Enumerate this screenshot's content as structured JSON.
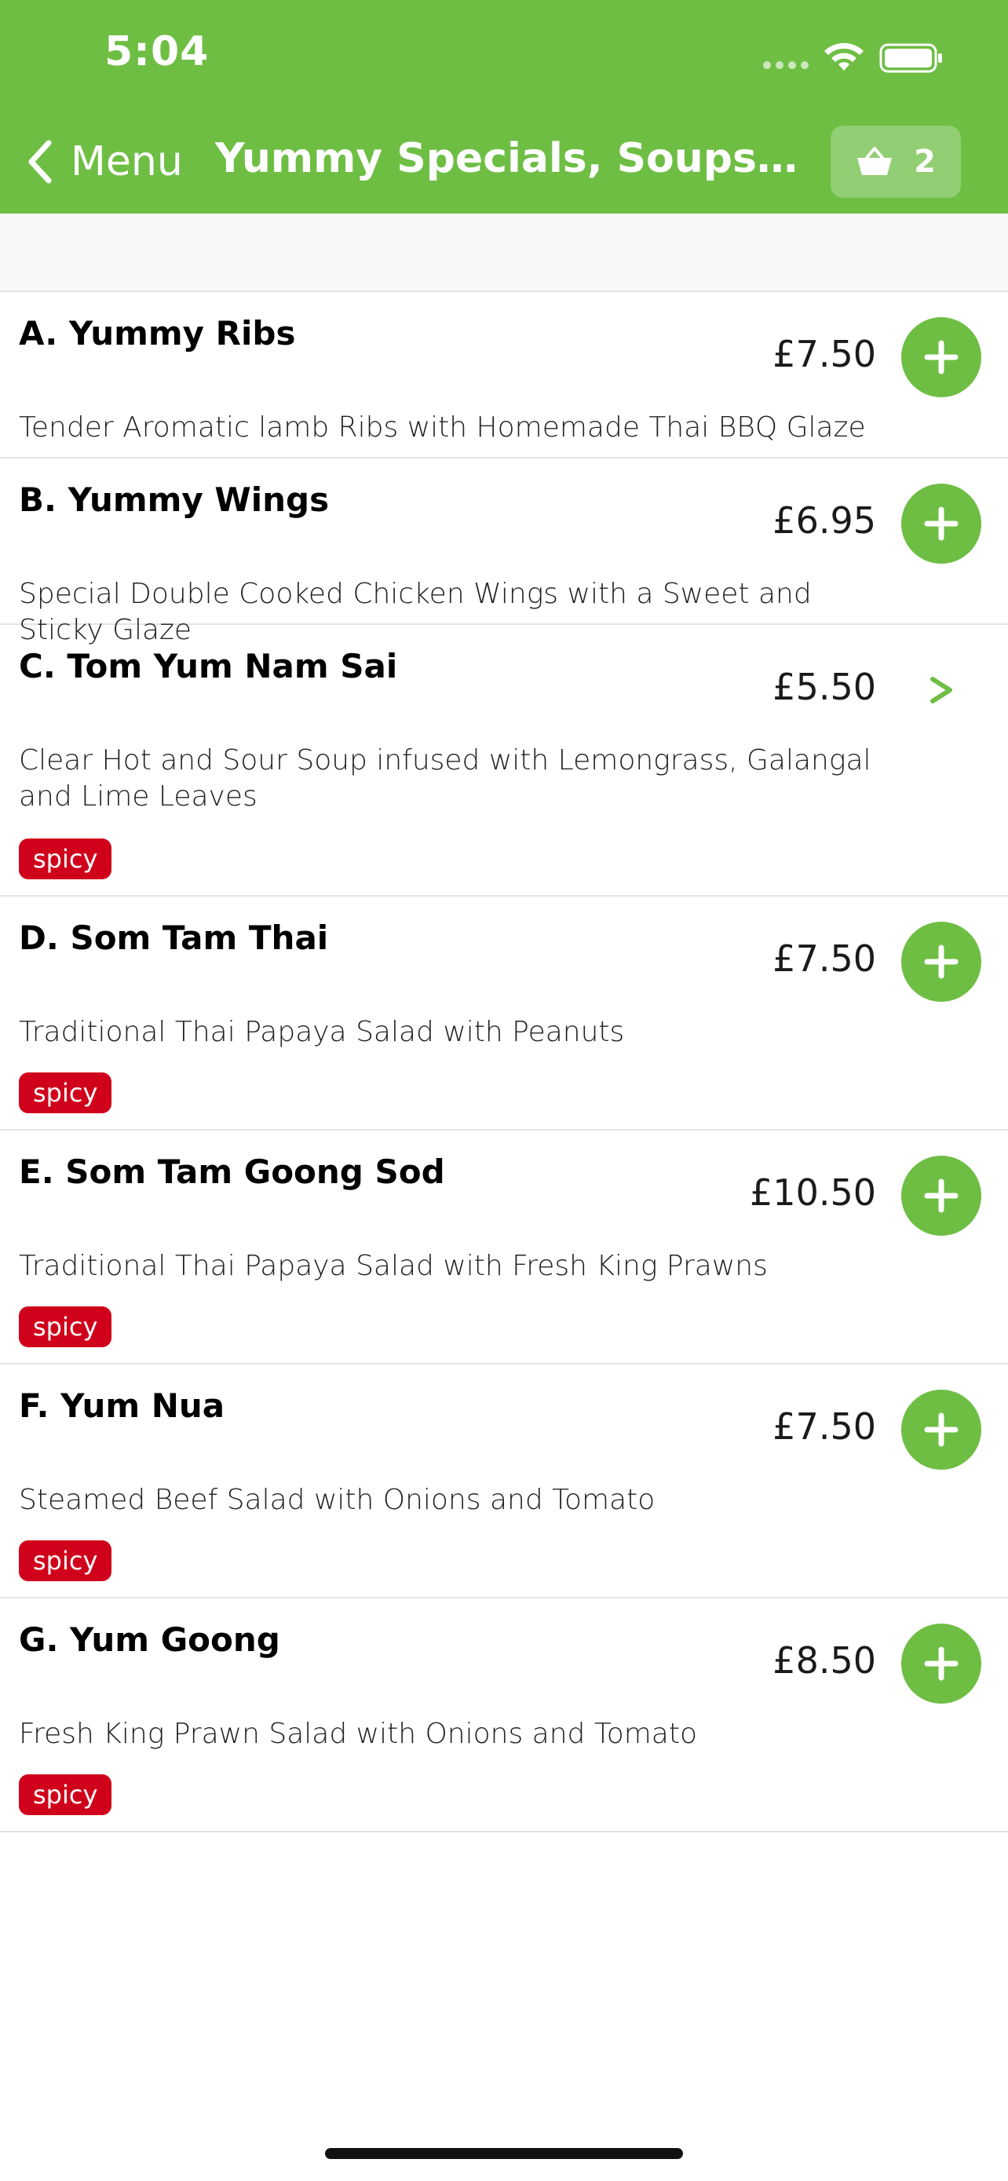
{
  "status_bar": {
    "time": "5:04"
  },
  "nav": {
    "back_label": "Menu",
    "title": "Yummy Specials, Soups, and S…",
    "basket_count": "2"
  },
  "colors": {
    "brand_green": "#6ebe44",
    "spicy_red": "#d0021b"
  },
  "items": [
    {
      "name": "A. Yummy Ribs",
      "price": "£7.50",
      "description": "Tender Aromatic lamb Ribs with Homemade Thai BBQ Glaze",
      "action": "add",
      "badge": ""
    },
    {
      "name": "B. Yummy Wings",
      "price": "£6.95",
      "description": "Special Double Cooked Chicken Wings with a Sweet and Sticky Glaze",
      "action": "add",
      "badge": ""
    },
    {
      "name": "C. Tom Yum Nam Sai",
      "price": "£5.50",
      "description": "Clear Hot and Sour Soup infused with Lemongrass, Galangal and Lime Leaves",
      "action": "chevron",
      "badge": "spicy"
    },
    {
      "name": "D. Som Tam Thai",
      "price": "£7.50",
      "description": "Traditional Thai Papaya Salad with Peanuts",
      "action": "add",
      "badge": "spicy"
    },
    {
      "name": "E. Som Tam Goong Sod",
      "price": "£10.50",
      "description": "Traditional Thai Papaya Salad with Fresh King Prawns",
      "action": "add",
      "badge": "spicy"
    },
    {
      "name": "F. Yum Nua",
      "price": "£7.50",
      "description": "Steamed Beef Salad with Onions and Tomato",
      "action": "add",
      "badge": "spicy"
    },
    {
      "name": "G. Yum Goong",
      "price": "£8.50",
      "description": "Fresh King Prawn Salad with Onions and Tomato",
      "action": "add",
      "badge": "spicy"
    }
  ]
}
